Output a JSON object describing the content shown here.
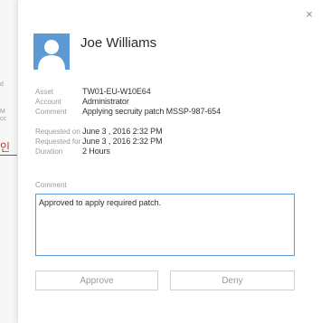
{
  "background": {
    "text_fragments": [
      "d",
      "M",
      "cc"
    ],
    "link_fragment": "인"
  },
  "dialog": {
    "user_name": "Joe Williams",
    "details": [
      {
        "label": "Asset",
        "value": "TW01-EU-W10E64"
      },
      {
        "label": "Account",
        "value": "Administrator"
      },
      {
        "label": "Comment",
        "value": "Applying secruity patch MSSP-987-654"
      },
      {
        "label": "Requested on",
        "value": "June  3 , 2016  2:32 PM"
      },
      {
        "label": "Requested for",
        "value": "June  3 , 2016  2:32 PM"
      },
      {
        "label": "Duration",
        "value": "2 Hours"
      }
    ],
    "comment_label": "Comment",
    "comment_value": "Approved to apply required patch.",
    "approve_label": "Approve",
    "deny_label": "Deny",
    "close_glyph": "×"
  },
  "colors": {
    "avatar": "#5d9ad3",
    "focus_border": "#5b9bd5",
    "link": "#c0392b"
  },
  "icons": {
    "close": "close-icon",
    "avatar": "user-silhouette-icon"
  }
}
